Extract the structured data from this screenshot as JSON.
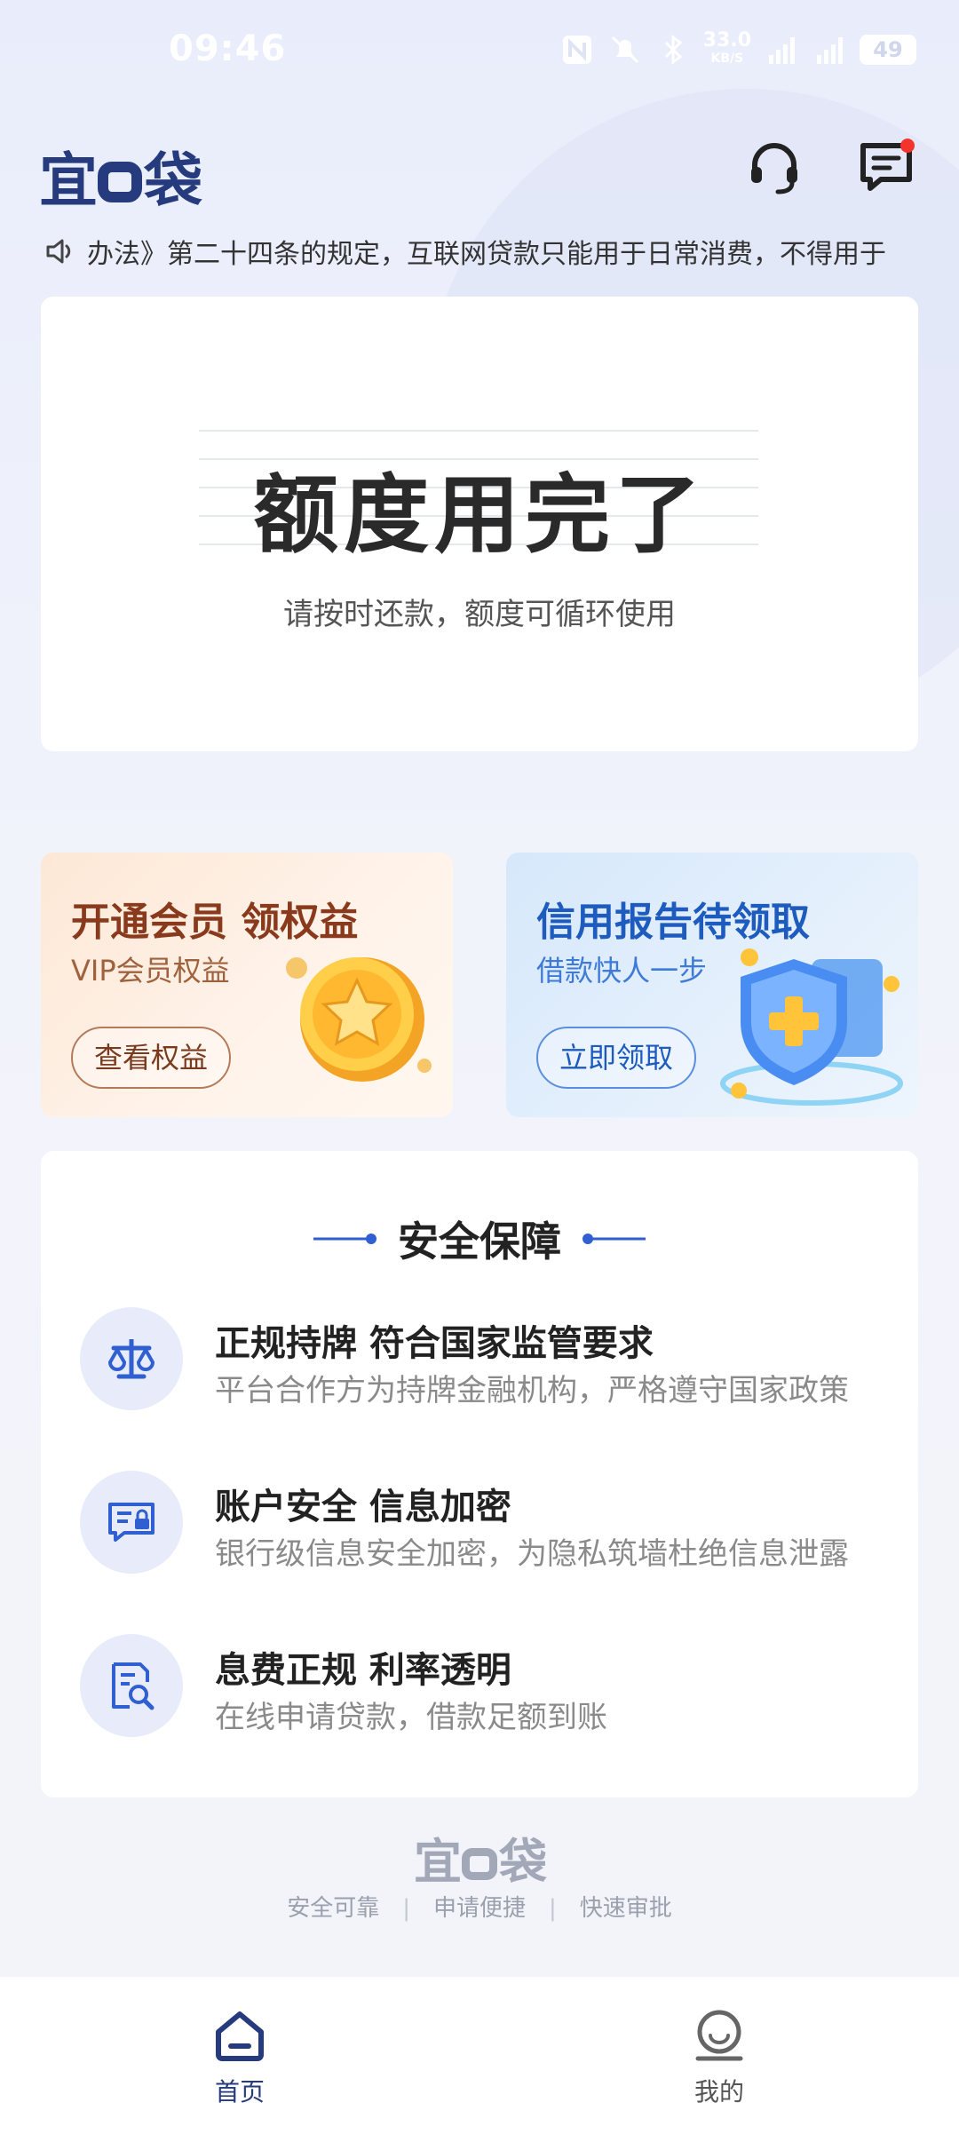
{
  "status_bar": {
    "time": "09:46",
    "net_speed": "33.0",
    "net_unit": "KB/S",
    "battery": "49"
  },
  "header": {
    "logo_left": "宜",
    "logo_right": "袋",
    "support_icon": "headset-icon",
    "message_icon": "message-icon"
  },
  "notice": {
    "icon": "speaker-icon",
    "text": "办法》第二十四条的规定，互联网贷款只能用于日常消费，不得用于"
  },
  "quota": {
    "title": "额度用完了",
    "subtitle": "请按时还款，额度可循环使用"
  },
  "promos": [
    {
      "title": "开通会员 领权益",
      "subtitle": "VIP会员权益",
      "button": "查看权益",
      "icon": "coin-star-icon"
    },
    {
      "title": "信用报告待领取",
      "subtitle": "借款快人一步",
      "button": "立即领取",
      "icon": "shield-plus-icon"
    }
  ],
  "security": {
    "title": "安全保障",
    "items": [
      {
        "icon": "balance-scale-icon",
        "title": "正规持牌 符合国家监管要求",
        "desc": "平台合作方为持牌金融机构，严格遵守国家政策"
      },
      {
        "icon": "secure-card-icon",
        "title": "账户安全 信息加密",
        "desc": "银行级信息安全加密，为隐私筑墙杜绝信息泄露"
      },
      {
        "icon": "document-search-icon",
        "title": "息费正规  利率透明",
        "desc": "在线申请贷款，借款足额到账"
      }
    ]
  },
  "footer": {
    "logo_left": "宜",
    "logo_right": "袋",
    "tags": [
      "安全可靠",
      "申请便捷",
      "快速审批"
    ]
  },
  "tabbar": {
    "home": "首页",
    "mine": "我的"
  },
  "colors": {
    "brand": "#263b7e",
    "accent_blue": "#1e5bbf",
    "vip_brown": "#8a3a1c",
    "badge_red": "#f2342d"
  }
}
